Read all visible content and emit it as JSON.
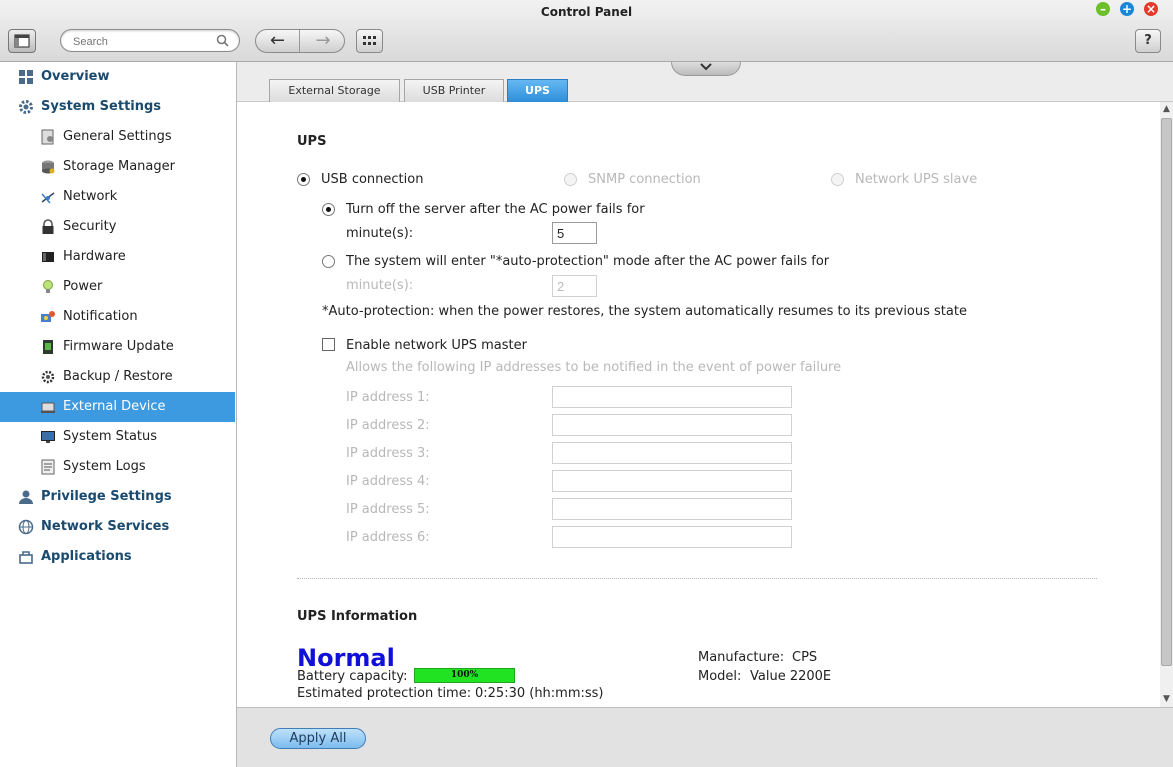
{
  "window": {
    "title": "Control Panel",
    "minimize_glyph": "–",
    "maximize_glyph": "+",
    "close_glyph": "×"
  },
  "toolbar": {
    "search_placeholder": "Search",
    "back_glyph": "←",
    "forward_glyph": "→",
    "help_label": "?"
  },
  "sidebar": {
    "items": [
      {
        "label": "Overview",
        "icon": "overview-icon"
      },
      {
        "label": "System Settings",
        "icon": "gear-icon"
      },
      {
        "label": "General Settings",
        "icon": "general-settings-icon"
      },
      {
        "label": "Storage Manager",
        "icon": "storage-icon"
      },
      {
        "label": "Network",
        "icon": "network-icon"
      },
      {
        "label": "Security",
        "icon": "lock-icon"
      },
      {
        "label": "Hardware",
        "icon": "hardware-icon"
      },
      {
        "label": "Power",
        "icon": "bulb-icon"
      },
      {
        "label": "Notification",
        "icon": "notification-icon"
      },
      {
        "label": "Firmware Update",
        "icon": "firmware-icon"
      },
      {
        "label": "Backup / Restore",
        "icon": "backup-icon"
      },
      {
        "label": "External Device",
        "icon": "external-device-icon"
      },
      {
        "label": "System Status",
        "icon": "monitor-icon"
      },
      {
        "label": "System Logs",
        "icon": "logs-icon"
      },
      {
        "label": "Privilege Settings",
        "icon": "user-icon"
      },
      {
        "label": "Network Services",
        "icon": "globe-icon"
      },
      {
        "label": "Applications",
        "icon": "applications-icon"
      }
    ],
    "active_item": "External Device"
  },
  "tabs": [
    {
      "label": "External Storage"
    },
    {
      "label": "USB Printer"
    },
    {
      "label": "UPS",
      "active": true
    }
  ],
  "ups": {
    "heading": "UPS",
    "usb_connection": "USB connection",
    "snmp_connection": "SNMP connection",
    "network_slave": "Network UPS slave",
    "turn_off_label": "Turn off the server after the AC power fails for",
    "minutes_label": "minute(s):",
    "turn_off_minutes": "5",
    "auto_protection_label": "The system will enter \"*auto-protection\" mode after the AC power fails for",
    "auto_protection_minutes": "2",
    "auto_protection_note": "*Auto-protection: when the power restores, the system automatically resumes to its previous state",
    "enable_master_label": "Enable network UPS master",
    "master_hint": "Allows the following IP addresses to be notified in the event of power failure",
    "ip_labels": [
      "IP address 1:",
      "IP address 2:",
      "IP address 3:",
      "IP address 4:",
      "IP address 5:",
      "IP address 6:"
    ]
  },
  "info": {
    "heading": "UPS Information",
    "status": "Normal",
    "battery_label": "Battery capacity:",
    "battery_value": "100%",
    "battery_fraction": 1.0,
    "protection_label": "Estimated protection time:",
    "protection_value": "0:25:30 (hh:mm:ss)",
    "manufacture_label": "Manufacture:",
    "manufacture_value": "CPS",
    "model_label": "Model:",
    "model_value": "Value 2200E"
  },
  "footer": {
    "apply_all": "Apply All"
  },
  "colors": {
    "accent": "#3d9ae0",
    "status_normal": "#1010d8",
    "battery_fill": "#21e321"
  }
}
